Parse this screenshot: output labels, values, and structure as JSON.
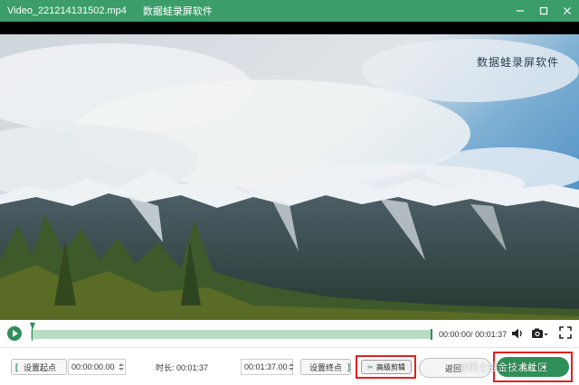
{
  "window": {
    "title": "Video_221214131502.mp4",
    "app_name": "数据蛙录屏软件",
    "minimize_icon": "minimize-icon",
    "maximize_icon": "maximize-icon",
    "close_icon": "close-icon"
  },
  "video": {
    "watermark": "数据蛙录屏软件"
  },
  "player": {
    "current_time": "00:00:00",
    "total_time": "00:01:37",
    "time_separator": "/ ",
    "progress_fraction": 0.0,
    "play_icon": "play-icon",
    "volume_icon": "volume-icon",
    "screenshot_icon": "camera-icon",
    "fullscreen_icon": "fullscreen-icon"
  },
  "trim": {
    "set_start_label": "设置起点",
    "start_time": "00:00:00.00",
    "duration_label": "时长: 00:01:37",
    "end_time": "00:01:37.00",
    "set_end_label": "设置终点",
    "left_bracket": "[",
    "right_bracket": "]"
  },
  "actions": {
    "advanced_edit_label": "高级剪辑",
    "back_label": "返回",
    "save_label": "完成",
    "advanced_edit_icon": "scissors-icon",
    "save_menu_icon": "chevron-down-icon"
  },
  "overlay": {
    "site_watermark": "@稀土掘金技术社区"
  },
  "colors": {
    "accent": "#3a9d6a",
    "highlight_box": "#e02020",
    "track": "#b9dcc2"
  }
}
